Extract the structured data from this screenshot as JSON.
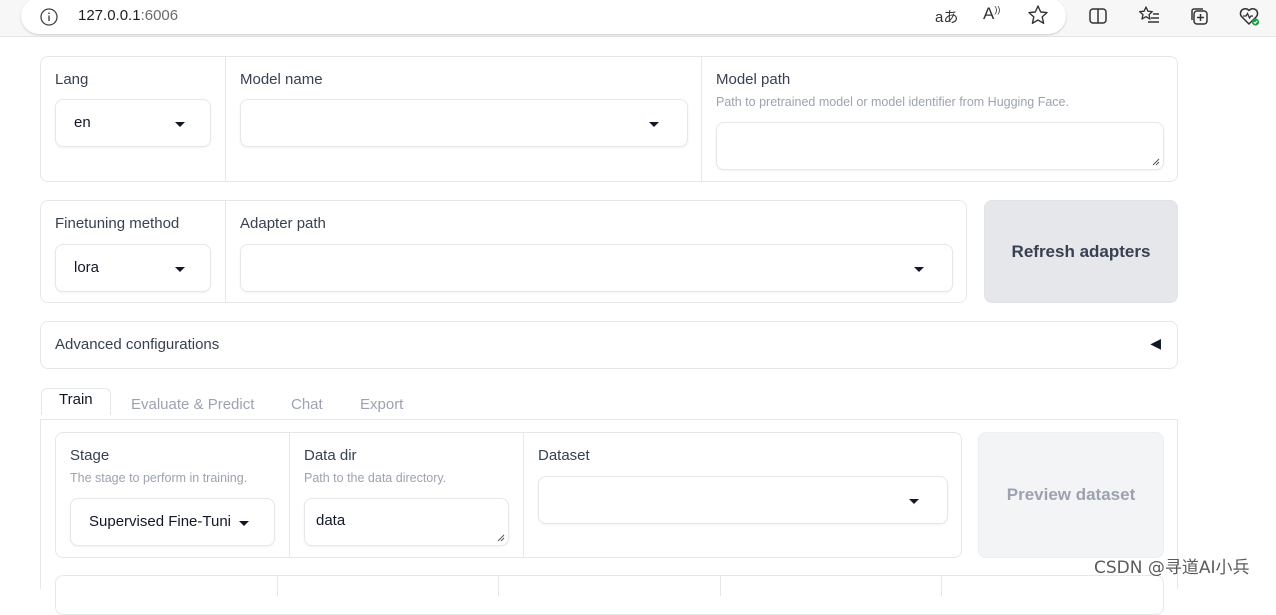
{
  "browser": {
    "url_host": "127.0.0.1",
    "url_port": ":6006",
    "translate_glyph": "aあ",
    "read_aloud_glyph": "A"
  },
  "top_row": {
    "lang": {
      "label": "Lang",
      "value": "en"
    },
    "model_name": {
      "label": "Model name",
      "value": ""
    },
    "model_path": {
      "label": "Model path",
      "info": "Path to pretrained model or model identifier from Hugging Face.",
      "value": ""
    }
  },
  "second_row": {
    "finetuning_method": {
      "label": "Finetuning method",
      "value": "lora"
    },
    "adapter_path": {
      "label": "Adapter path",
      "value": ""
    },
    "refresh_button": "Refresh adapters"
  },
  "advanced": {
    "label": "Advanced configurations",
    "toggle_glyph": "◀"
  },
  "tabs": [
    {
      "label": "Train",
      "active": true
    },
    {
      "label": "Evaluate & Predict",
      "active": false
    },
    {
      "label": "Chat",
      "active": false
    },
    {
      "label": "Export",
      "active": false
    }
  ],
  "train": {
    "stage": {
      "label": "Stage",
      "info": "The stage to perform in training.",
      "value": "Supervised Fine-Tuni"
    },
    "data_dir": {
      "label": "Data dir",
      "info": "Path to the data directory.",
      "value": "data"
    },
    "dataset": {
      "label": "Dataset",
      "value": ""
    },
    "preview_button": "Preview dataset"
  },
  "watermark": "CSDN @寻道AI小兵",
  "colors": {
    "border": "#e5e7eb",
    "button_bg": "#e5e7eb",
    "muted_text": "#9ca3af"
  },
  "icons": [
    "info-icon",
    "translate-icon",
    "read-aloud-icon",
    "favorite-star-icon",
    "split-screen-icon",
    "favorites-list-icon",
    "collections-icon",
    "browser-essentials-icon"
  ]
}
